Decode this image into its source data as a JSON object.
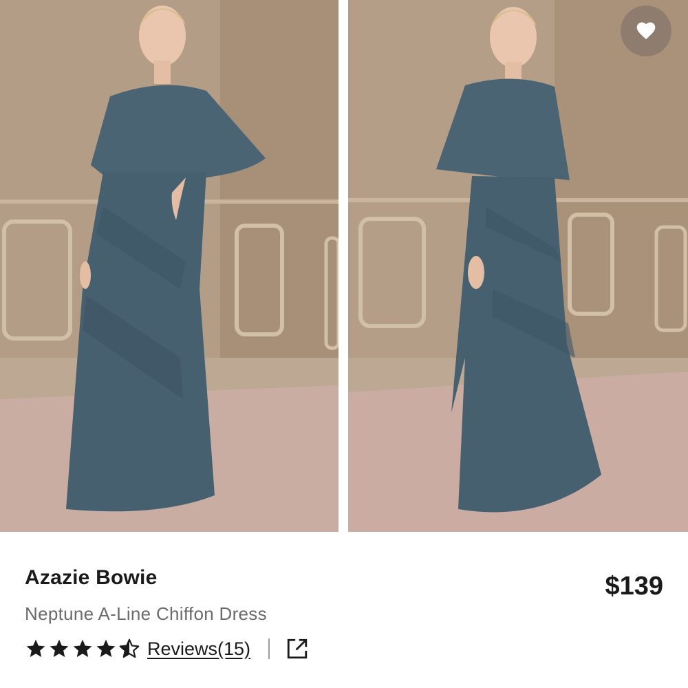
{
  "product": {
    "brand": "Azazie Bowie",
    "name": "Neptune A-Line Chiffon Dress",
    "price": "$139",
    "rating": 4.5,
    "rating_max": 5,
    "reviews_label": "Reviews(15)"
  },
  "gallery": {
    "images": [
      {
        "alt": "Model wearing dress, front view"
      },
      {
        "alt": "Model wearing dress, angled view"
      }
    ]
  },
  "icons": {
    "favorite": "heart-icon",
    "share": "external-link-icon",
    "star_full": "star-filled-icon",
    "star_half": "star-half-icon"
  },
  "colors": {
    "dress": "#46606f",
    "wall": "#b39c84",
    "floor": "#c7a8a0",
    "text_primary": "#1a1a1a",
    "text_secondary": "#6b6b6b"
  }
}
